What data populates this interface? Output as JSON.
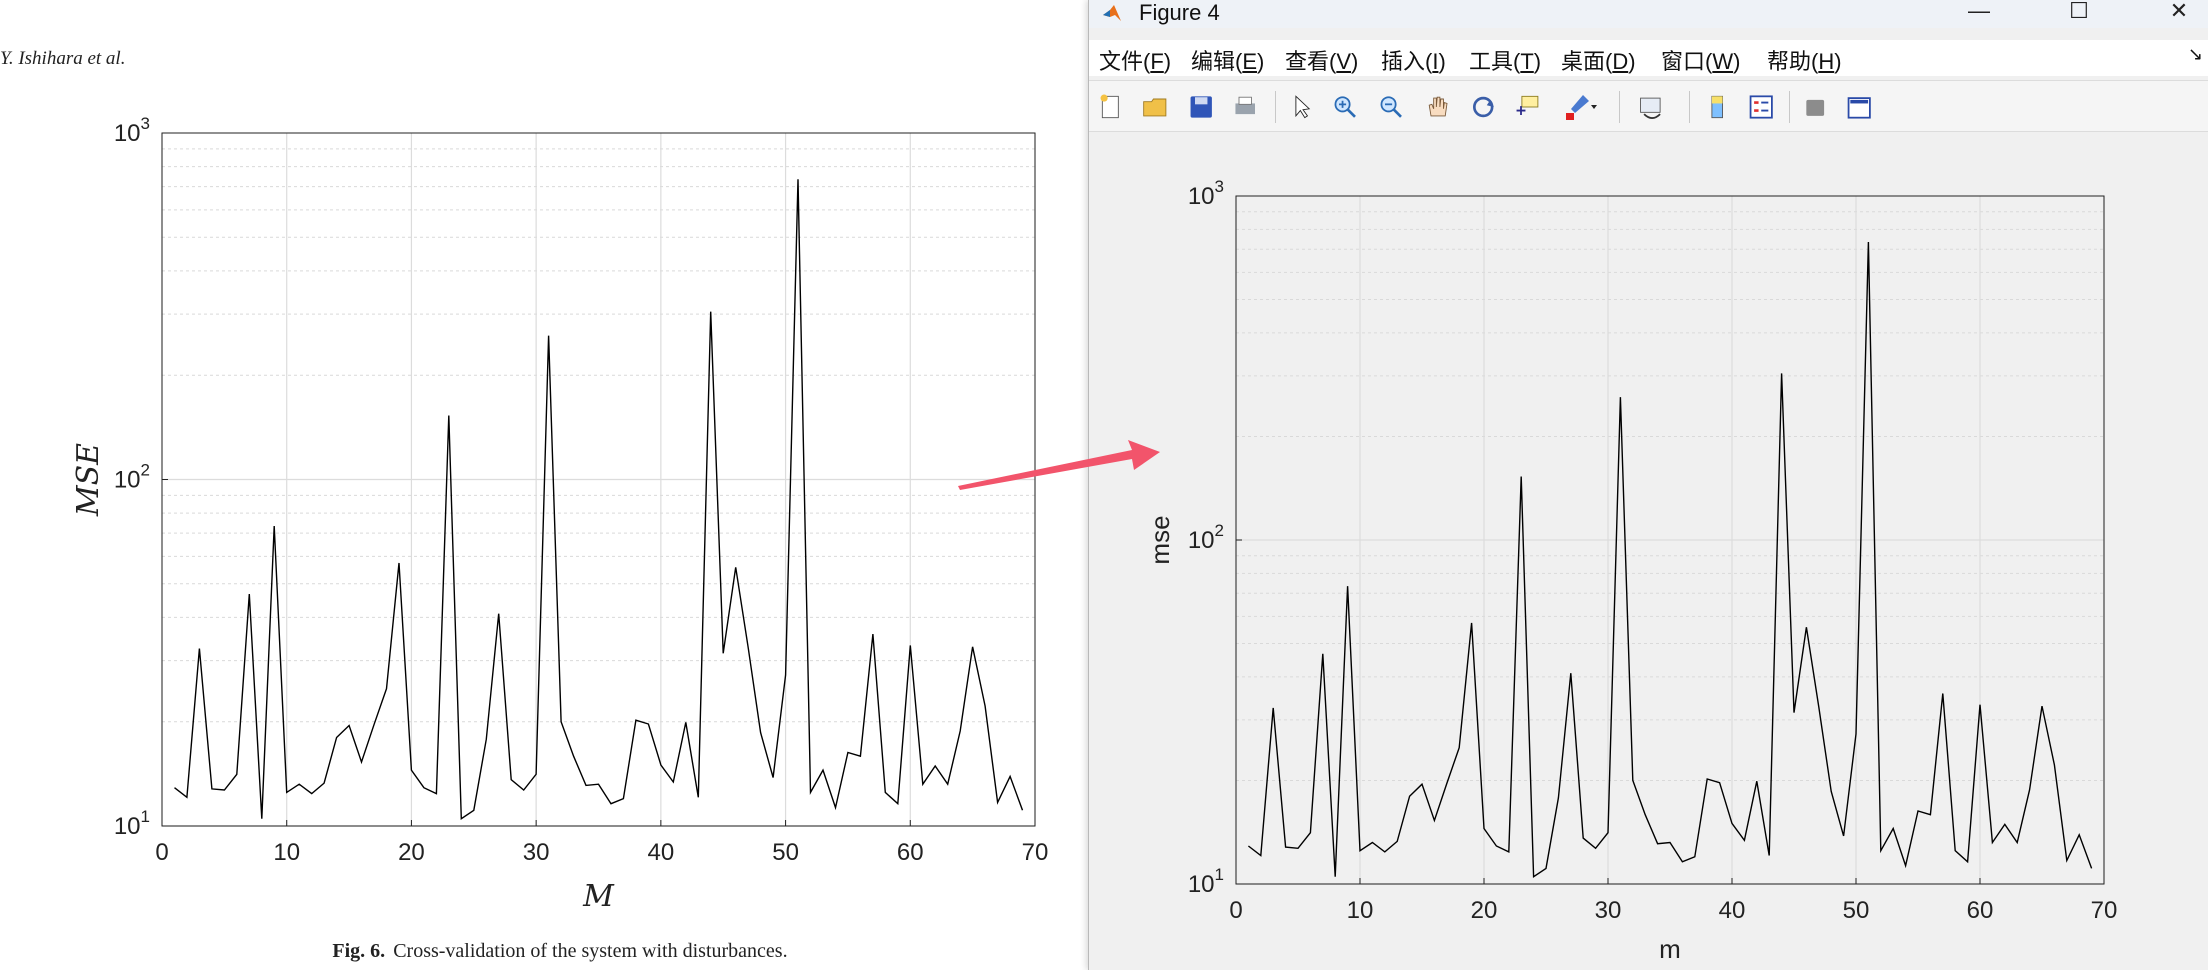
{
  "paper": {
    "running_head": "Y. Ishihara et al.",
    "caption_label": "Fig. 6.",
    "caption_text": "Cross-validation of the system with disturbances."
  },
  "window": {
    "title": "Figure 4",
    "menu": [
      {
        "label": "文件(",
        "acc": "F",
        "end": ")"
      },
      {
        "label": "编辑(",
        "acc": "E",
        "end": ")"
      },
      {
        "label": "查看(",
        "acc": "V",
        "end": ")"
      },
      {
        "label": "插入(",
        "acc": "I",
        "end": ")"
      },
      {
        "label": "工具(",
        "acc": "T",
        "end": ")"
      },
      {
        "label": "桌面(",
        "acc": "D",
        "end": ")"
      },
      {
        "label": "窗口(",
        "acc": "W",
        "end": ")"
      },
      {
        "label": "帮助(",
        "acc": "H",
        "end": ")"
      }
    ],
    "toolbar_icons": [
      "new-figure-icon",
      "open-file-icon",
      "save-icon",
      "print-icon",
      "pointer-icon",
      "zoom-in-icon",
      "zoom-out-icon",
      "pan-icon",
      "rotate-3d-icon",
      "data-cursor-icon",
      "brush-icon",
      "link-plot-icon",
      "colorbar-icon",
      "legend-icon",
      "hide-plot-tools-icon",
      "show-plot-tools-icon"
    ]
  },
  "colors": {
    "arrow": "#f2546b",
    "line": "#000000",
    "grid": "#dcdcdc"
  },
  "chart_data": [
    {
      "type": "line",
      "yscale": "log",
      "xlabel": "M",
      "ylabel": "MSE",
      "xlim": [
        0,
        70
      ],
      "ylim": [
        10,
        1000
      ],
      "xticks": [
        "0",
        "10",
        "20",
        "30",
        "40",
        "50",
        "60",
        "70"
      ],
      "yticks": [
        "10^1",
        "10^2",
        "10^3"
      ],
      "grid": true,
      "x": [
        1,
        2,
        3,
        4,
        5,
        6,
        7,
        8,
        9,
        10,
        11,
        12,
        13,
        14,
        15,
        16,
        17,
        18,
        19,
        20,
        21,
        22,
        23,
        24,
        25,
        26,
        27,
        28,
        29,
        30,
        31,
        32,
        33,
        34,
        35,
        36,
        37,
        38,
        39,
        40,
        41,
        42,
        43,
        44,
        45,
        46,
        47,
        48,
        49,
        50,
        51,
        52,
        53,
        54,
        55,
        56,
        57,
        58,
        59,
        60,
        61,
        62,
        63,
        64,
        65,
        66,
        67,
        68,
        69
      ],
      "y": [
        12.9,
        12.1,
        32.5,
        12.8,
        12.7,
        14.1,
        46.7,
        10.5,
        73.4,
        12.5,
        13.2,
        12.4,
        13.3,
        18.0,
        19.5,
        15.3,
        19.6,
        24.9,
        57.4,
        14.5,
        12.9,
        12.4,
        153.0,
        10.5,
        11.1,
        17.8,
        41.0,
        13.6,
        12.7,
        14.1,
        260.0,
        20.0,
        15.9,
        13.1,
        13.2,
        11.6,
        12.0,
        20.2,
        19.7,
        15.0,
        13.4,
        19.9,
        12.1,
        305.0,
        31.5,
        55.8,
        32.7,
        18.6,
        13.8,
        27.3,
        735.0,
        12.5,
        14.5,
        11.3,
        16.3,
        15.9,
        35.8,
        12.5,
        11.6,
        33.2,
        13.2,
        14.9,
        13.2,
        18.8,
        32.9,
        22.2,
        11.7,
        13.9,
        11.1
      ]
    },
    {
      "type": "line",
      "yscale": "log",
      "xlabel": "m",
      "ylabel": "mse",
      "xlim": [
        0,
        70
      ],
      "ylim": [
        10,
        1000
      ],
      "xticks": [
        "0",
        "10",
        "20",
        "30",
        "40",
        "50",
        "60",
        "70"
      ],
      "yticks": [
        "10^1",
        "10^2",
        "10^3"
      ],
      "grid": true,
      "x": [
        1,
        2,
        3,
        4,
        5,
        6,
        7,
        8,
        9,
        10,
        11,
        12,
        13,
        14,
        15,
        16,
        17,
        18,
        19,
        20,
        21,
        22,
        23,
        24,
        25,
        26,
        27,
        28,
        29,
        30,
        31,
        32,
        33,
        34,
        35,
        36,
        37,
        38,
        39,
        40,
        41,
        42,
        43,
        44,
        45,
        46,
        47,
        48,
        49,
        50,
        51,
        52,
        53,
        54,
        55,
        56,
        57,
        58,
        59,
        60,
        61,
        62,
        63,
        64,
        65,
        66,
        67,
        68,
        69
      ],
      "y": [
        12.9,
        12.1,
        32.5,
        12.8,
        12.7,
        14.1,
        46.7,
        10.5,
        73.4,
        12.5,
        13.2,
        12.4,
        13.3,
        18.0,
        19.5,
        15.3,
        19.6,
        24.9,
        57.4,
        14.5,
        12.9,
        12.4,
        153.0,
        10.5,
        11.1,
        17.8,
        41.0,
        13.6,
        12.7,
        14.1,
        260.0,
        20.0,
        15.9,
        13.1,
        13.2,
        11.6,
        12.0,
        20.2,
        19.7,
        15.0,
        13.4,
        19.9,
        12.1,
        305.0,
        31.5,
        55.8,
        32.7,
        18.6,
        13.8,
        27.3,
        735.0,
        12.5,
        14.5,
        11.3,
        16.3,
        15.9,
        35.8,
        12.5,
        11.6,
        33.2,
        13.2,
        14.9,
        13.2,
        18.8,
        32.9,
        22.2,
        11.7,
        13.9,
        11.1
      ]
    }
  ]
}
